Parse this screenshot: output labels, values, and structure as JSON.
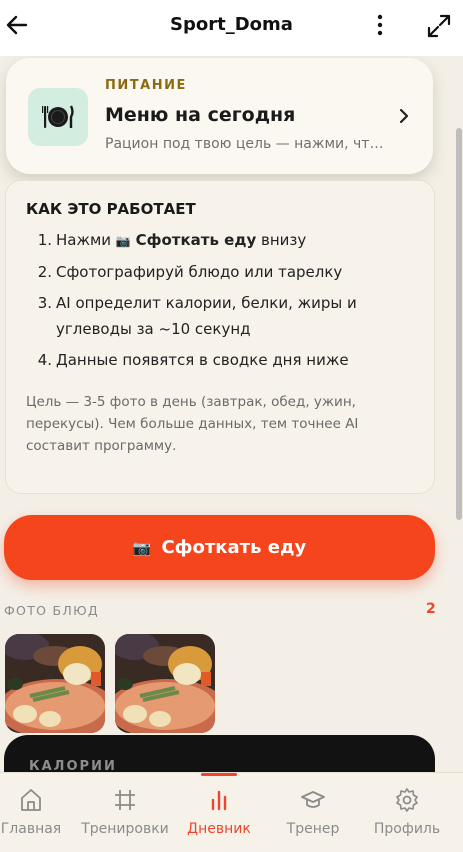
{
  "header": {
    "title": "Sport_Doma",
    "back_icon": "arrow-left-icon",
    "more_icon": "more-vertical-icon",
    "expand_icon": "expand-icon"
  },
  "menu_card": {
    "eyebrow": "ПИТАНИЕ",
    "title": "Меню на сегодня",
    "subtitle": "Рацион под твою цель — нажми, что...",
    "icon": "plate-cutlery-icon"
  },
  "how_it_works": {
    "title": "КАК ЭТО РАБОТАЕТ",
    "steps": [
      {
        "num": "1.",
        "pre": "Нажми ",
        "emoji": "📷",
        "bold": "Сфоткать еду",
        "post": " внизу"
      },
      {
        "num": "2.",
        "text": "Сфотографируй блюдо или тарелку"
      },
      {
        "num": "3.",
        "text": "AI определит калории, белки, жиры и углеводы за ~10 секунд"
      },
      {
        "num": "4.",
        "text": "Данные появятся в сводке дня ниже"
      }
    ],
    "note": "Цель — 3-5 фото в день (завтрак, обед, ужин, перекусы). Чем больше данных, тем точнее AI составит программу."
  },
  "cta": {
    "emoji": "📷",
    "label": "Сфоткать еду"
  },
  "photos": {
    "heading": "ФОТО БЛЮД",
    "count": "2"
  },
  "calories": {
    "label": "КАЛОРИИ"
  },
  "tabs": [
    {
      "label": "Главная",
      "icon": "home-icon",
      "active": false
    },
    {
      "label": "Тренировки",
      "icon": "workouts-icon",
      "active": false
    },
    {
      "label": "Дневник",
      "icon": "bar-chart-icon",
      "active": true
    },
    {
      "label": "Тренер",
      "icon": "graduation-cap-icon",
      "active": false
    },
    {
      "label": "Профиль",
      "icon": "gear-icon",
      "active": false
    }
  ],
  "colors": {
    "accent": "#f5451c",
    "background": "#f3efe7",
    "eyebrow": "#8a6b12",
    "icon_box": "#d4ede1"
  }
}
